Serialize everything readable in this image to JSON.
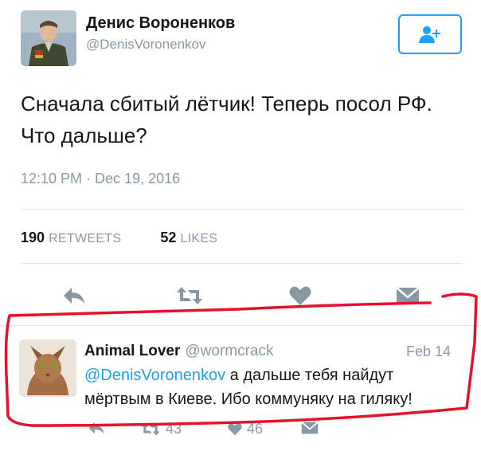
{
  "tweet": {
    "display_name": "Денис Вороненков",
    "handle": "@DenisVoronenkov",
    "text_line1": "Сначала сбитый лётчик! Теперь посол РФ.",
    "text_line2": "Что дальше?",
    "timestamp": "12:10 PM · Dec 19, 2016",
    "retweets_count": "190",
    "retweets_label": "RETWEETS",
    "likes_count": "52",
    "likes_label": "LIKES"
  },
  "actions": [
    "reply-icon",
    "retweet-icon",
    "like-icon",
    "direct-message-icon"
  ],
  "reply": {
    "display_name": "Animal Lover",
    "handle": "@wormcrack",
    "date": "Feb 14",
    "mention": "@DenisVoronenkov",
    "text_rest_line1": " а дальше тебя найдут",
    "text_line2": "мёртвым в Киеве. Ибо коммуняку на гиляку!",
    "retweets_count": "43",
    "likes_count": "46"
  },
  "colors": {
    "accent": "#1da1f2",
    "muted": "#8899a6",
    "annotation": "#e8112d"
  }
}
